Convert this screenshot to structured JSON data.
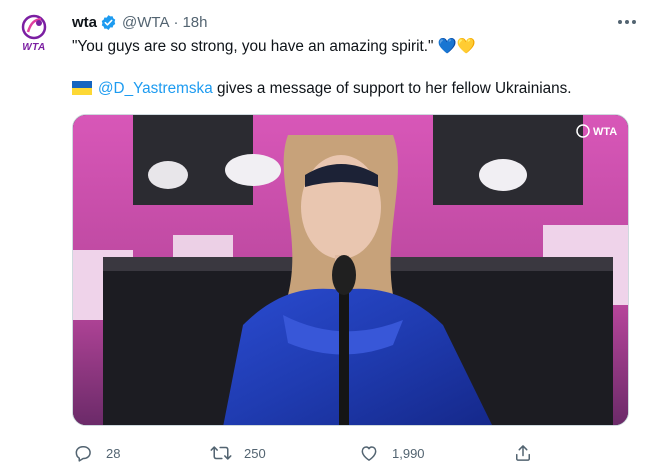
{
  "account": {
    "name": "wta",
    "handle": "@WTA",
    "separator": "·",
    "time": "18h",
    "avatar_label": "WTA",
    "accent": "#7b1fa2"
  },
  "tweet": {
    "line1": "\"You guys are so strong, you have an amazing spirit.\" 💙💛",
    "mention": "@D_Yastremska",
    "line2_rest": " gives a message of support to her fellow Ukrainians."
  },
  "media": {
    "watermark": "WTA",
    "icon": "video-still"
  },
  "actions": {
    "reply_count": "28",
    "retweet_count": "250",
    "like_count": "1,990"
  },
  "colors": {
    "link": "#1d9bf0",
    "secondary": "#536471",
    "verified": "#1d9bf0"
  }
}
